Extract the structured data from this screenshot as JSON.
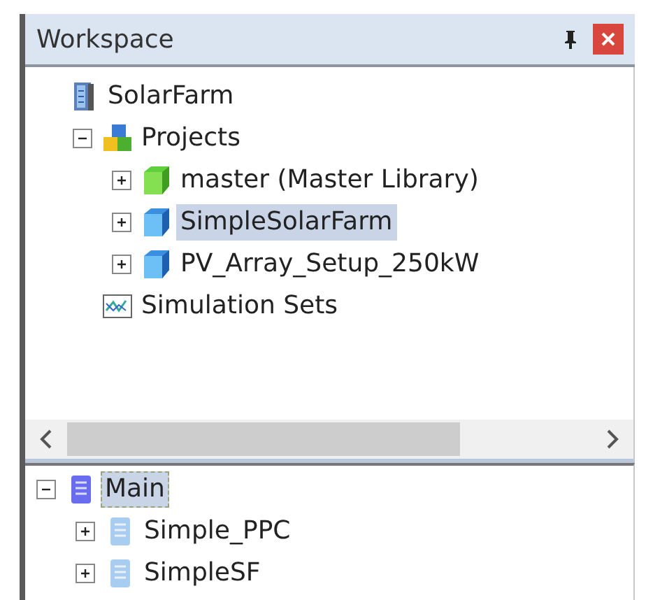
{
  "window": {
    "title": "Workspace"
  },
  "workspace_tree": [
    {
      "label": "SolarFarm",
      "kind": "database",
      "selected": false,
      "children": [
        {
          "label": "Projects",
          "kind": "projects",
          "expanded": true,
          "selected": false,
          "children": [
            {
              "label": "master (Master Library)",
              "kind": "library",
              "expanded": false,
              "selected": false
            },
            {
              "label": "SimpleSolarFarm",
              "kind": "project",
              "expanded": false,
              "selected": true
            },
            {
              "label": "PV_Array_Setup_250kW",
              "kind": "project",
              "expanded": false,
              "selected": false
            }
          ]
        },
        {
          "label": "Simulation Sets",
          "kind": "simulation",
          "selected": false
        }
      ]
    }
  ],
  "module_tree": [
    {
      "label": "Main",
      "kind": "main-document",
      "expanded": true,
      "selected": true,
      "children": [
        {
          "label": "Simple_PPC",
          "kind": "document",
          "expanded": false,
          "selected": false
        },
        {
          "label": "SimpleSF",
          "kind": "document",
          "expanded": false,
          "selected": false
        }
      ]
    }
  ]
}
